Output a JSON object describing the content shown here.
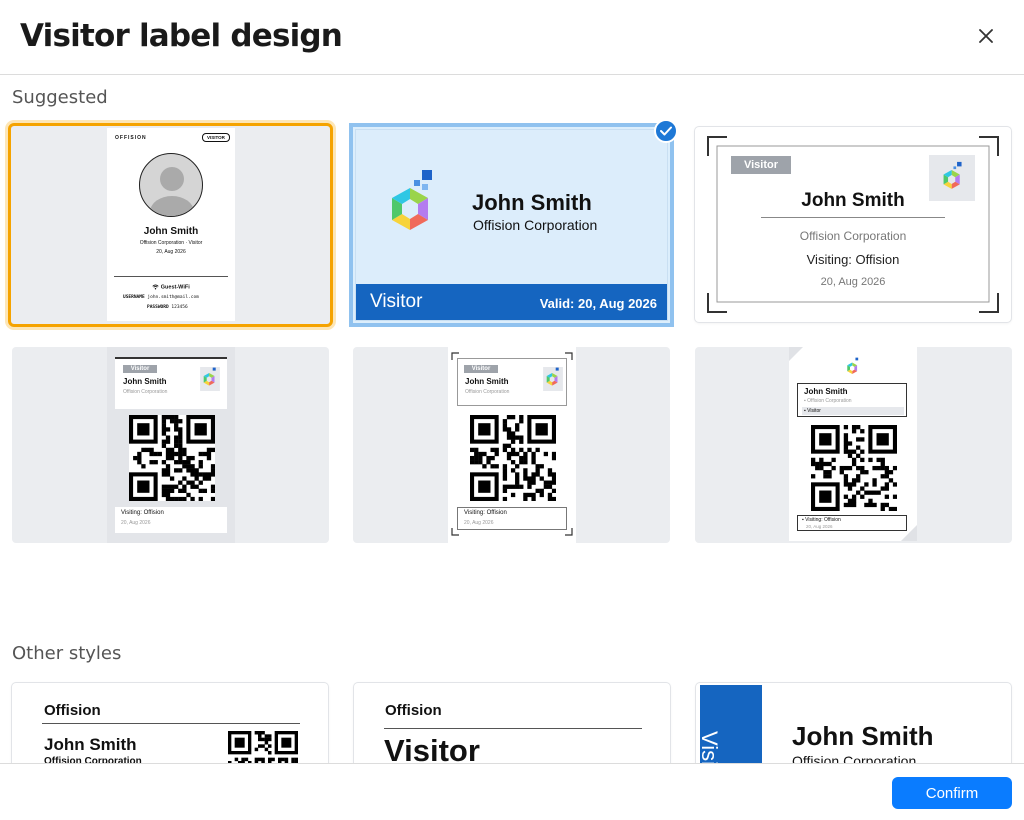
{
  "dialog": {
    "title": "Visitor label design",
    "close_label": "×",
    "confirm_label": "Confirm"
  },
  "sections": {
    "suggested": "Suggested",
    "other": "Other styles"
  },
  "colors": {
    "accent": "#0a7cff",
    "hover_border": "#f5a300",
    "selected_border": "#90c2ef",
    "badge_blue": "#1565c0",
    "tag_gray": "#9ea3aa"
  },
  "person": {
    "name": "John Smith",
    "company": "Offision Corporation",
    "company_visitor": "Offision Corporation  ·  Visitor",
    "date": "20, Aug 2026",
    "visiting": "Visiting: Offision",
    "role": "Visitor",
    "valid": "Valid: 20, Aug 2026"
  },
  "badge1": {
    "brand": "OFFISION",
    "tag": "VISITOR",
    "wifi_title": "Guest-WiFi",
    "username_label": "USERNAME",
    "username_value": "john.smith@mail.com",
    "password_label": "PASSWORD",
    "password_value": "123456"
  },
  "other_styles": {
    "brand": "Offision",
    "visitor_big": "Visitor",
    "vertical_text": "Visitor"
  },
  "icons": [
    "close-icon",
    "check-icon",
    "avatar-icon",
    "wifi-icon",
    "logo-icon",
    "qr-code-icon"
  ]
}
